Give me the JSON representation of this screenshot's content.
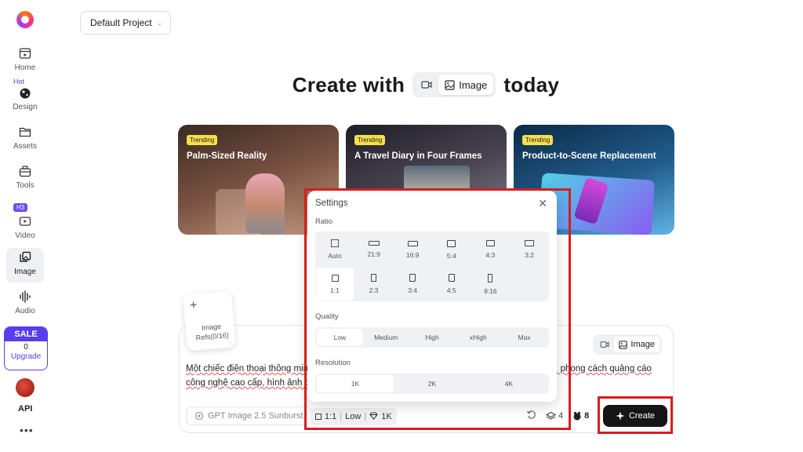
{
  "sidebar": {
    "items": [
      {
        "label": "Home"
      },
      {
        "label": "Design"
      },
      {
        "label": "Assets"
      },
      {
        "label": "Tools"
      },
      {
        "label": "Video"
      },
      {
        "label": "Image"
      },
      {
        "label": "Audio"
      }
    ],
    "hot_tag": "Hot",
    "h3_tag": "H3",
    "sale": {
      "title": "SALE",
      "count": "0",
      "upgrade": "Upgrade"
    },
    "api": "API",
    "more": "•••"
  },
  "project": {
    "label": "Default Project"
  },
  "hero": {
    "pre": "Create with",
    "mode_label": "Image",
    "post": "today"
  },
  "cards": [
    {
      "tag": "Trending",
      "title": "Palm-Sized Reality"
    },
    {
      "tag": "Trending",
      "title": "A Travel Diary in Four Frames"
    },
    {
      "tag": "Trending",
      "title": "Product-to-Scene Replacement"
    }
  ],
  "refs": {
    "plus": "+",
    "label": "Image Refs(0/16)"
  },
  "prompt": {
    "text": "Một chiếc điện thoại thông minh ... tối giản, ánh sáng xanh và tím chiếu từ hai bên, sản phẩ... phong cách quảng cáo công nghệ cao cấp, hình ảnh chân th...",
    "mode_label": "Image",
    "model": "GPT Image 2.5 Sunburst",
    "settings_summary": {
      "ratio": "1:1",
      "quality": "Low",
      "resolution": "1K"
    },
    "layers_count": "4",
    "credits": "8",
    "create_label": "Create"
  },
  "settings": {
    "title": "Settings",
    "ratio_label": "Ratio",
    "ratios": [
      "Auto",
      "21:9",
      "16:9",
      "5:4",
      "4:3",
      "3:2",
      "1:1",
      "2:3",
      "3:4",
      "4:5",
      "9:16"
    ],
    "selected_ratio": "1:1",
    "quality_label": "Quality",
    "qualities": [
      "Low",
      "Medium",
      "High",
      "xHigh",
      "Max"
    ],
    "selected_quality": "Low",
    "resolution_label": "Resolution",
    "resolutions": [
      "1K",
      "2K",
      "4K"
    ],
    "selected_resolution": "1K"
  },
  "colors": {
    "accent": "#5a3df0",
    "highlight": "#d81e1e",
    "trending": "#f5e04a"
  }
}
